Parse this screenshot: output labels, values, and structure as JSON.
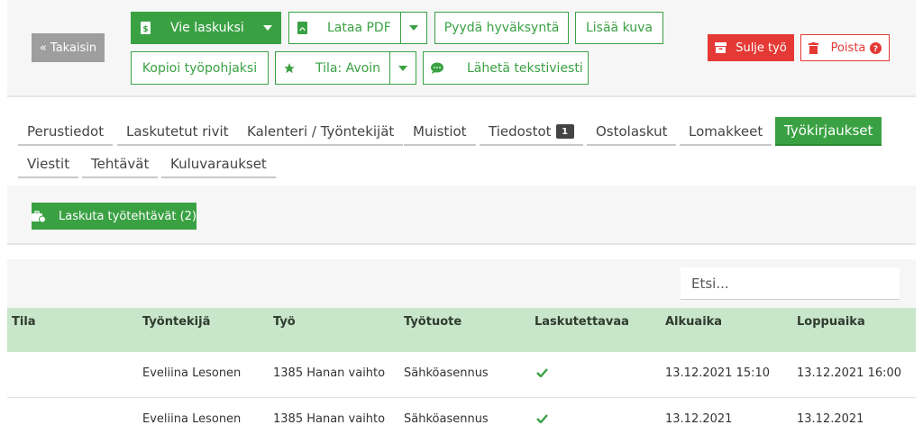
{
  "toolbar": {
    "back_label": "« Takaisin",
    "invoice_label": "Vie laskuksi",
    "pdf_label": "Lataa PDF",
    "request_approval_label": "Pyydä hyväksyntä",
    "add_image_label": "Lisää kuva",
    "copy_template_label": "Kopioi työpohjaksi",
    "status_label": "Tila: Avoin",
    "sms_label": "Lähetä tekstiviesti",
    "close_job_label": "Sulje työ",
    "delete_label": "Poista"
  },
  "tabs": [
    {
      "label": "Perustiedot"
    },
    {
      "label": "Laskutetut rivit"
    },
    {
      "label": "Kalenteri / Työntekijät"
    },
    {
      "label": "Muistiot"
    },
    {
      "label": "Tiedostot",
      "badge": "1"
    },
    {
      "label": "Ostolaskut"
    },
    {
      "label": "Lomakkeet"
    },
    {
      "label": "Työkirjaukset",
      "active": true
    },
    {
      "label": "Viestit"
    },
    {
      "label": "Tehtävät"
    },
    {
      "label": "Kuluvaraukset"
    }
  ],
  "invoice_tasks_label": "Laskuta työtehtävät (2)",
  "search": {
    "placeholder": "Etsi..."
  },
  "table": {
    "headers": [
      "Tila",
      "Työntekijä",
      "Työ",
      "Työtuote",
      "Laskutettavaa",
      "Alkuaika",
      "Loppuaika"
    ],
    "rows": [
      {
        "tila": "",
        "employee": "Eveliina Lesonen",
        "job": "1385 Hanan vaihto",
        "product": "Sähköasennus",
        "billable": true,
        "start": "13.12.2021 15:10",
        "end": "13.12.2021 16:00"
      },
      {
        "tila": "",
        "employee": "Eveliina Lesonen",
        "job": "1385 Hanan vaihto",
        "product": "Sähköasennus",
        "billable": true,
        "start": "13.12.2021",
        "end": "13.12.2021"
      }
    ]
  },
  "colors": {
    "green": "#3aa143",
    "light_green": "#c8e6c9",
    "red": "#e53935",
    "grey": "#9e9e9e"
  }
}
